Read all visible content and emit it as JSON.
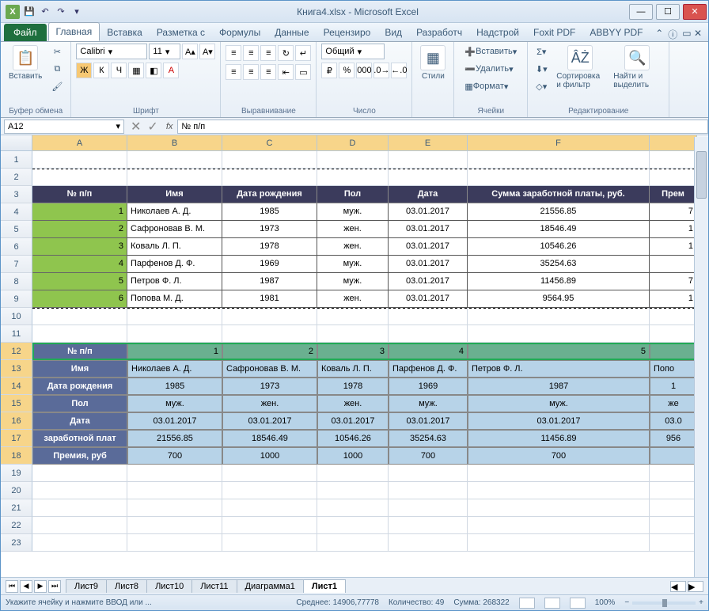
{
  "title": "Книга4.xlsx  -  Microsoft Excel",
  "qat": {
    "save": "💾",
    "undo": "↶",
    "redo": "↷"
  },
  "fileTab": "Файл",
  "tabs": [
    "Главная",
    "Вставка",
    "Разметка с",
    "Формулы",
    "Данные",
    "Рецензиро",
    "Вид",
    "Разработч",
    "Надстрой",
    "Foxit PDF",
    "ABBYY PDF"
  ],
  "ribbon": {
    "clipboard": {
      "paste": "Вставить",
      "label": "Буфер обмена"
    },
    "font": {
      "name": "Calibri",
      "size": "11",
      "label": "Шрифт",
      "bold": "Ж",
      "italic": "К",
      "underline": "Ч"
    },
    "align": {
      "label": "Выравнивание"
    },
    "number": {
      "format": "Общий",
      "label": "Число"
    },
    "styles": {
      "label": "Стили"
    },
    "cells": {
      "insert": "Вставить",
      "delete": "Удалить",
      "format": "Формат",
      "label": "Ячейки"
    },
    "editing": {
      "sort": "Сортировка и фильтр",
      "find": "Найти и выделить",
      "label": "Редактирование"
    }
  },
  "namebox": "A12",
  "formula": "№ п/п",
  "cols": [
    "A",
    "B",
    "C",
    "D",
    "E",
    "F"
  ],
  "rows": [
    "1",
    "2",
    "3",
    "4",
    "5",
    "6",
    "7",
    "8",
    "9",
    "10",
    "11",
    "12",
    "13",
    "14",
    "15",
    "16",
    "17",
    "18",
    "19",
    "20",
    "21",
    "22",
    "23"
  ],
  "t1": {
    "headers": [
      "№ п/п",
      "Имя",
      "Дата рождения",
      "Пол",
      "Дата",
      "Сумма заработной платы, руб.",
      "Прем"
    ],
    "rows": [
      {
        "n": "1",
        "name": "Николаев А. Д.",
        "y": "1985",
        "s": "муж.",
        "d": "03.01.2017",
        "sum": "21556.85",
        "p": "7"
      },
      {
        "n": "2",
        "name": "Сафроновав В. М.",
        "y": "1973",
        "s": "жен.",
        "d": "03.01.2017",
        "sum": "18546.49",
        "p": "1"
      },
      {
        "n": "3",
        "name": "Коваль Л. П.",
        "y": "1978",
        "s": "жен.",
        "d": "03.01.2017",
        "sum": "10546.26",
        "p": "1"
      },
      {
        "n": "4",
        "name": "Парфенов Д. Ф.",
        "y": "1969",
        "s": "муж.",
        "d": "03.01.2017",
        "sum": "35254.63",
        "p": ""
      },
      {
        "n": "5",
        "name": "Петров Ф. Л.",
        "y": "1987",
        "s": "муж.",
        "d": "03.01.2017",
        "sum": "11456.89",
        "p": "7"
      },
      {
        "n": "6",
        "name": "Попова М. Д.",
        "y": "1981",
        "s": "жен.",
        "d": "03.01.2017",
        "sum": "9564.95",
        "p": "1"
      }
    ]
  },
  "t2": {
    "labels": [
      "№ п/п",
      "Имя",
      "Дата рождения",
      "Пол",
      "Дата",
      "заработной плат",
      "Премия, руб"
    ],
    "cols": [
      {
        "n": "1",
        "name": "Николаев А. Д.",
        "y": "1985",
        "s": "муж.",
        "d": "03.01.2017",
        "sum": "21556.85",
        "p": "700"
      },
      {
        "n": "2",
        "name": "Сафроновав В. М.",
        "y": "1973",
        "s": "жен.",
        "d": "03.01.2017",
        "sum": "18546.49",
        "p": "1000"
      },
      {
        "n": "3",
        "name": "Коваль Л. П.",
        "y": "1978",
        "s": "жен.",
        "d": "03.01.2017",
        "sum": "10546.26",
        "p": "1000"
      },
      {
        "n": "4",
        "name": "Парфенов Д. Ф.",
        "y": "1969",
        "s": "муж.",
        "d": "03.01.2017",
        "sum": "35254.63",
        "p": "700"
      },
      {
        "n": "5",
        "name": "Петров Ф. Л.",
        "y": "1987",
        "s": "муж.",
        "d": "03.01.2017",
        "sum": "11456.89",
        "p": "700"
      },
      {
        "n": "",
        "name": "Попо",
        "y": "1",
        "s": "же",
        "d": "03.0",
        "sum": "956",
        "p": ""
      }
    ]
  },
  "sheets": [
    "Лист9",
    "Лист8",
    "Лист10",
    "Лист11",
    "Диаграмма1",
    "Лист1"
  ],
  "status": {
    "prompt": "Укажите ячейку и нажмите ВВОД или ...",
    "avg": "Среднее: 14906,77778",
    "count": "Количество: 49",
    "sum": "Сумма: 268322",
    "zoom": "100%"
  }
}
